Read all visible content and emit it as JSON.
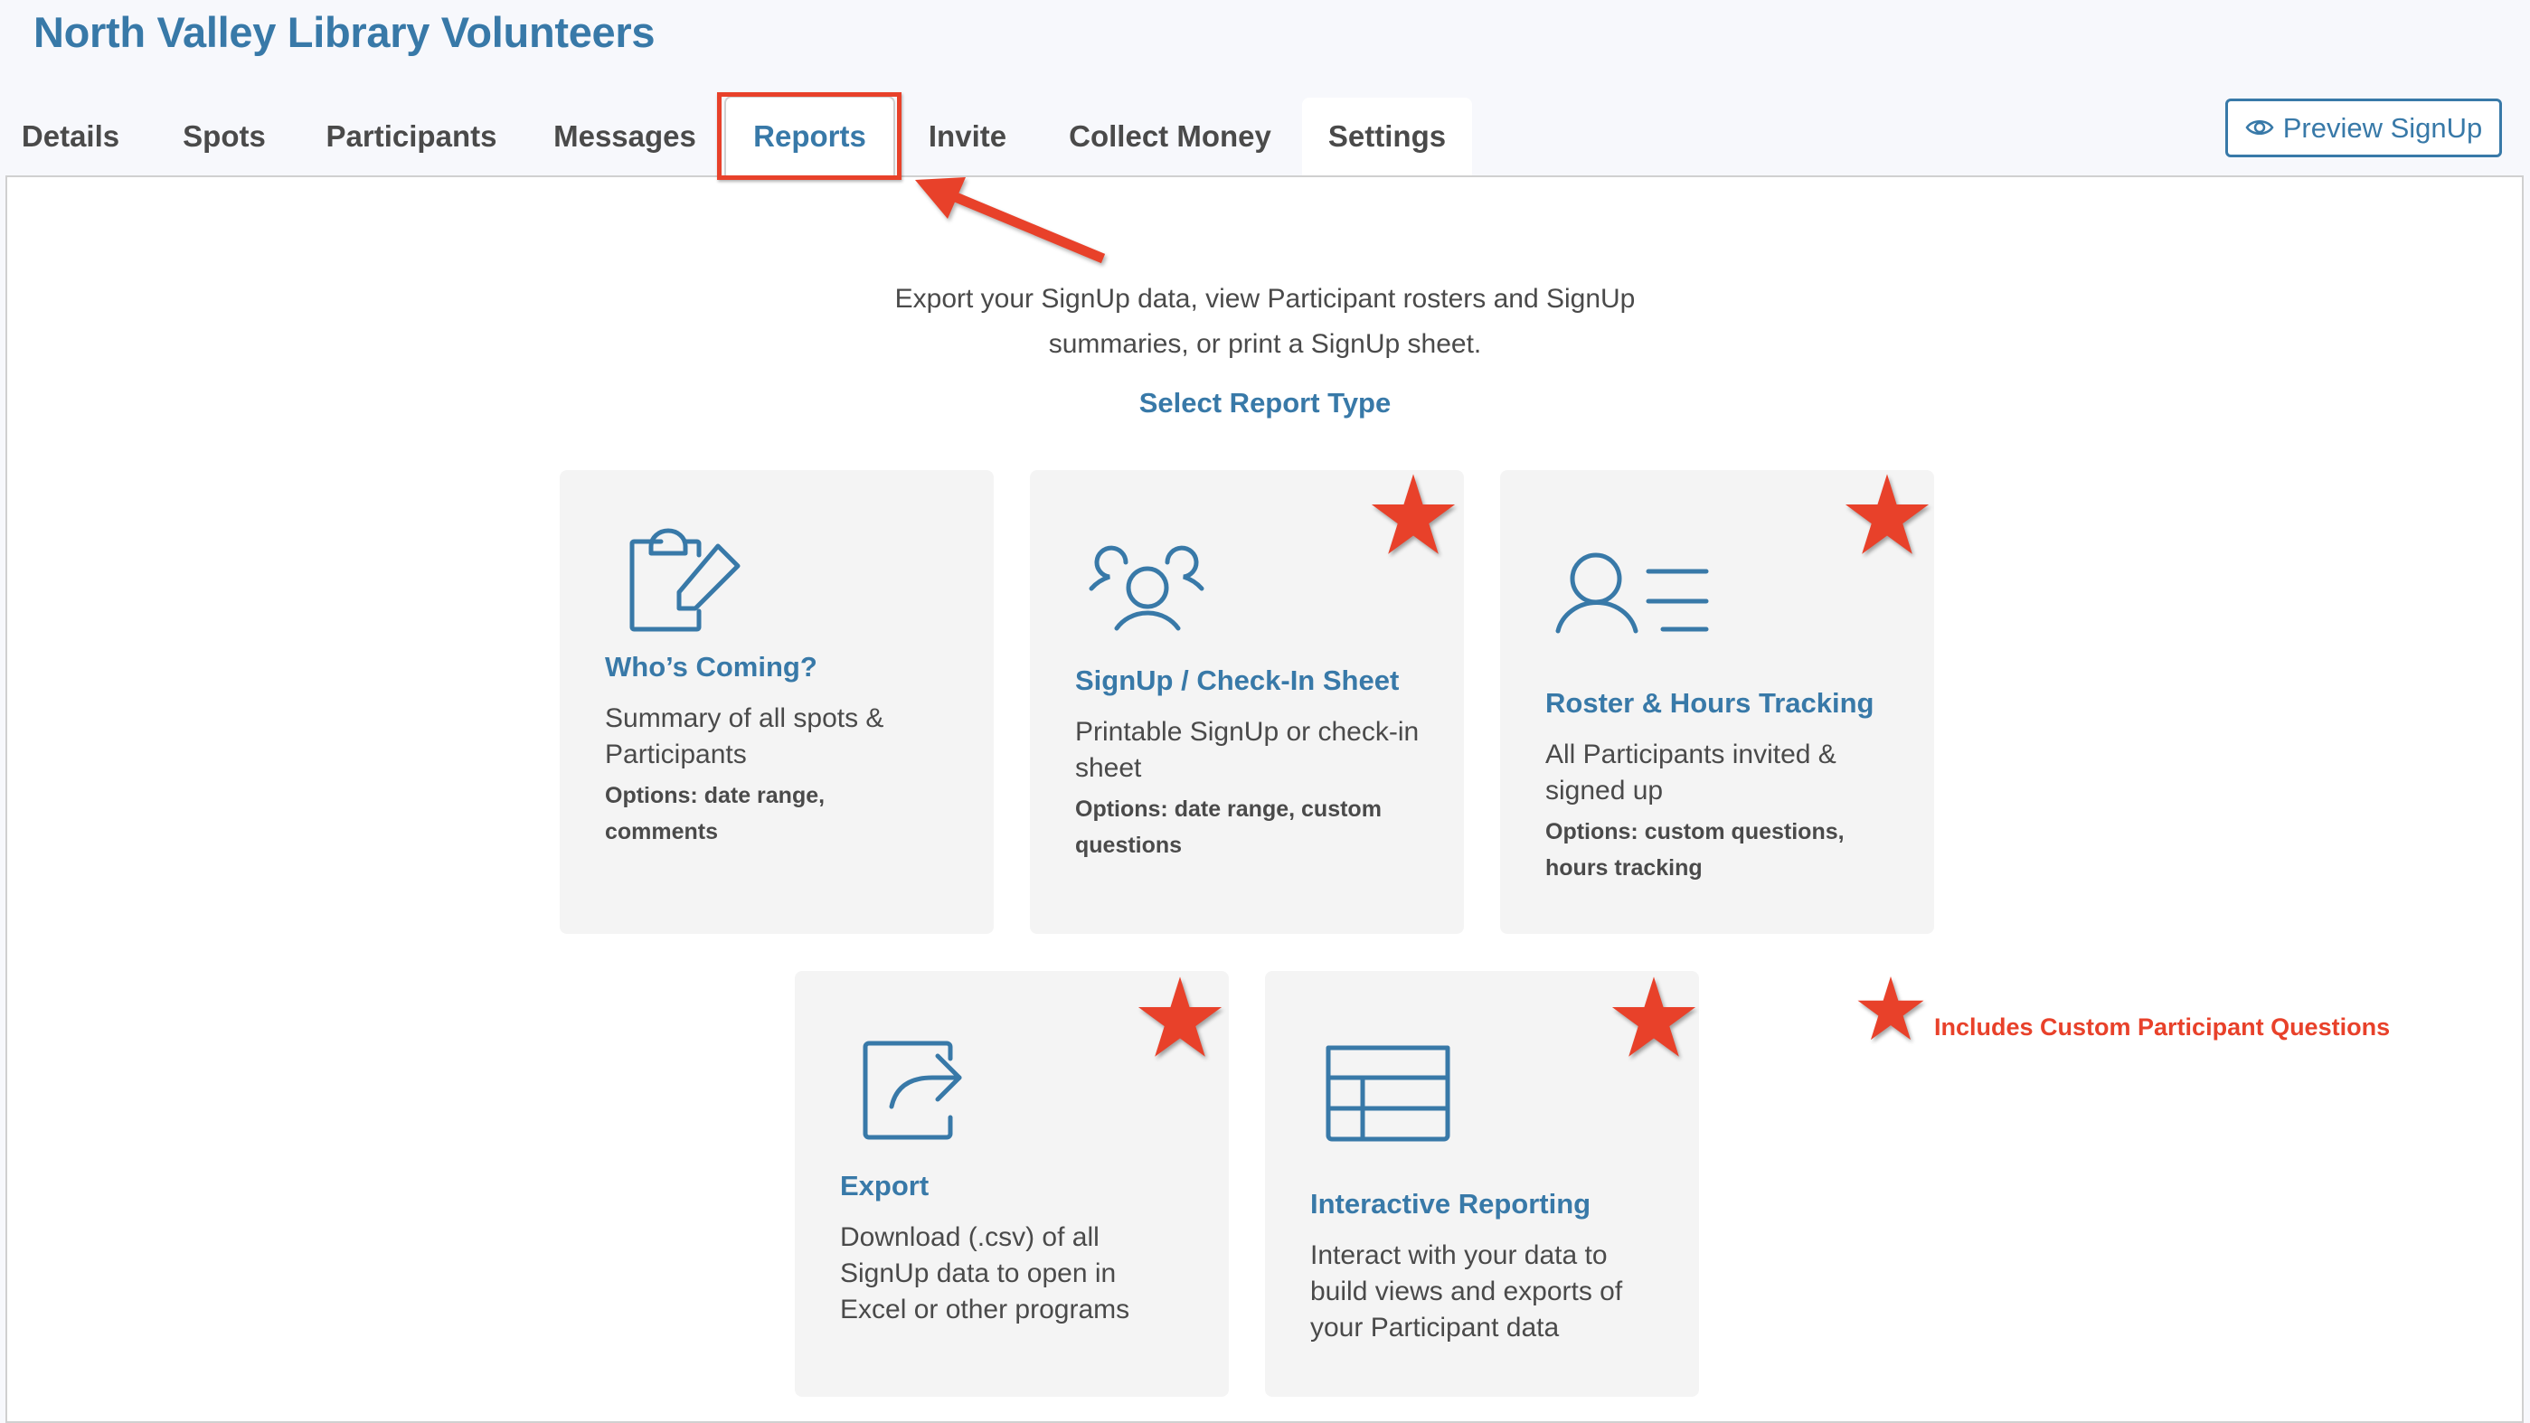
{
  "header": {
    "title": "North Valley Library Volunteers",
    "preview_button": {
      "label": "Preview SignUp",
      "icon": "eye-icon"
    }
  },
  "tabs": [
    {
      "label": "Details",
      "state": "default"
    },
    {
      "label": "Spots",
      "state": "default"
    },
    {
      "label": "Participants",
      "state": "default"
    },
    {
      "label": "Messages",
      "state": "default"
    },
    {
      "label": "Reports",
      "state": "active"
    },
    {
      "label": "Invite",
      "state": "default"
    },
    {
      "label": "Collect Money",
      "state": "default"
    },
    {
      "label": "Settings",
      "state": "hover"
    }
  ],
  "main": {
    "intro_line1": "Export your SignUp data, view Participant rosters and SignUp",
    "intro_line2": "summaries, or print a SignUp sheet.",
    "select_label": "Select Report Type",
    "cards": [
      {
        "title": "Who’s Coming?",
        "icon": "clipboard-edit-icon",
        "description": "Summary of all spots & Participants",
        "options": "Options: date range, comments",
        "starred": false
      },
      {
        "title": "SignUp / Check-In Sheet",
        "icon": "group-users-icon",
        "description": "Printable SignUp or check-in sheet",
        "options": "Options: date range, custom questions",
        "starred": true
      },
      {
        "title": "Roster & Hours Tracking",
        "icon": "user-list-icon",
        "description": "All Participants invited & signed up",
        "options": "Options: custom questions, hours tracking",
        "starred": true
      },
      {
        "title": "Export",
        "icon": "export-share-icon",
        "description": "Download (.csv) of all SignUp data to open in Excel or other programs",
        "options": "",
        "starred": true
      },
      {
        "title": "Interactive Reporting",
        "icon": "table-grid-icon",
        "description": "Interact with your data to build views and exports of your Participant data",
        "options": "",
        "starred": true
      }
    ]
  },
  "annotations": {
    "legend_text": "Includes Custom Participant Questions",
    "highlight_target": "Reports",
    "color": "#e8412a"
  },
  "colors": {
    "brand_blue": "#3879a8",
    "card_bg": "#f4f4f4",
    "page_bg": "#f7f8fc",
    "annotation_red": "#e8412a"
  }
}
